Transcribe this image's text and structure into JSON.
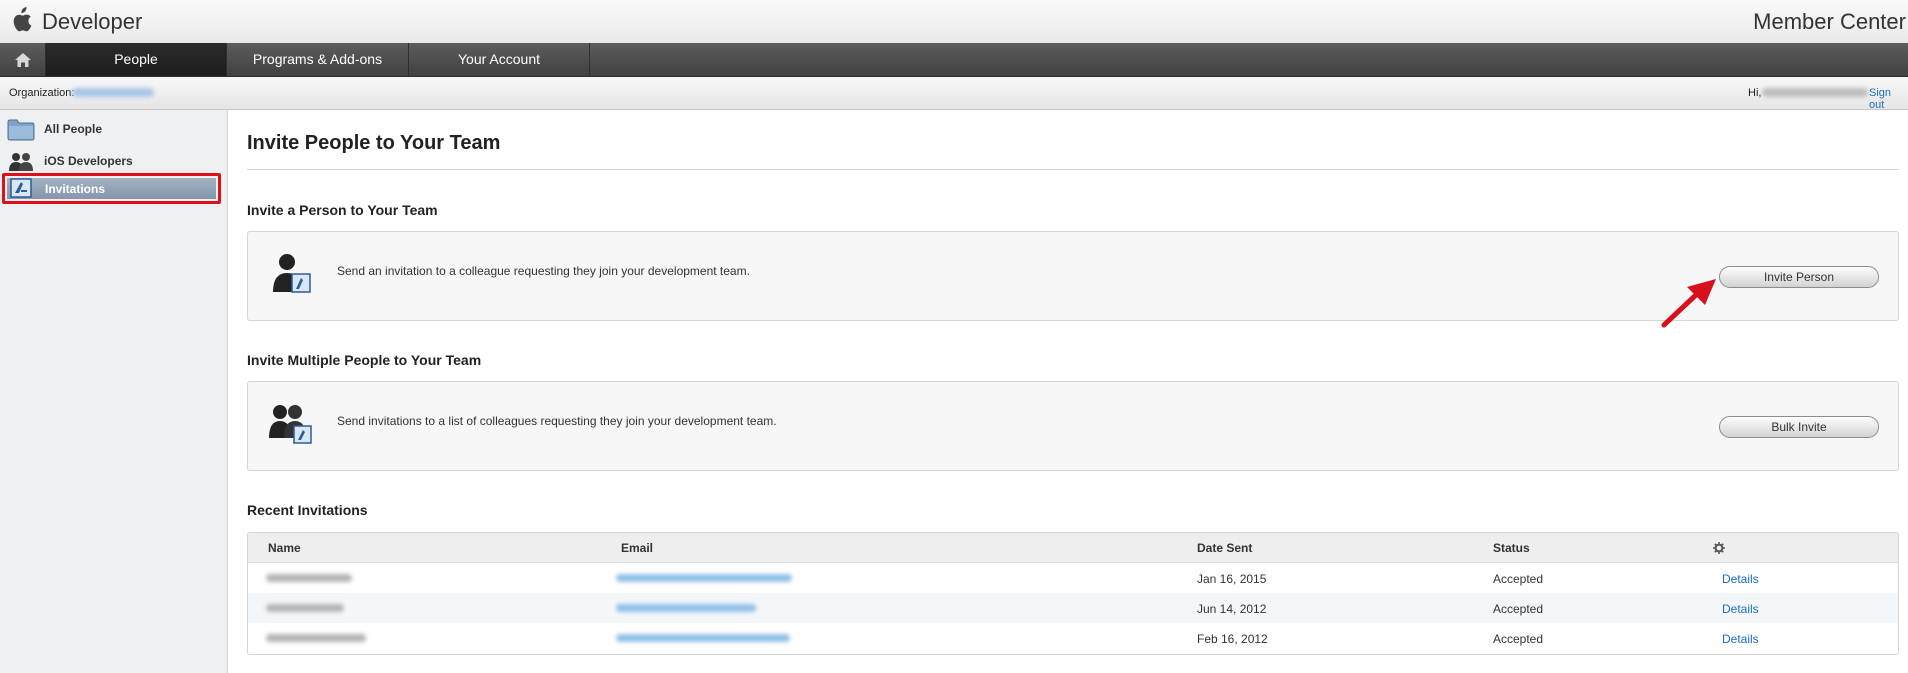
{
  "header": {
    "brand": "Developer",
    "member_center": "Member Center"
  },
  "nav": {
    "tabs": [
      {
        "label": "People",
        "active": true
      },
      {
        "label": "Programs & Add-ons",
        "active": false
      },
      {
        "label": "Your Account",
        "active": false
      }
    ]
  },
  "subbar": {
    "organization_label": "Organization:",
    "greeting": "Hi,",
    "sign_out": "Sign out"
  },
  "sidebar": {
    "items": [
      {
        "label": "All People",
        "icon": "folder-icon"
      },
      {
        "label": "iOS Developers",
        "icon": "people-icon"
      },
      {
        "label": "Invitations",
        "icon": "invitation-icon",
        "active": true
      }
    ]
  },
  "main": {
    "title": "Invite People to Your Team",
    "invite_person": {
      "heading": "Invite a Person to Your Team",
      "description": "Send an invitation to a colleague requesting they join your development team.",
      "button": "Invite Person"
    },
    "invite_multiple": {
      "heading": "Invite Multiple People to Your Team",
      "description": "Send invitations to a list of colleagues requesting they join your development team.",
      "button": "Bulk Invite"
    },
    "recent": {
      "heading": "Recent Invitations",
      "columns": [
        "Name",
        "Email",
        "Date Sent",
        "Status"
      ],
      "rows": [
        {
          "date": "Jan 16, 2015",
          "status": "Accepted",
          "action": "Details"
        },
        {
          "date": "Jun 14, 2012",
          "status": "Accepted",
          "action": "Details"
        },
        {
          "date": "Feb 16, 2012",
          "status": "Accepted",
          "action": "Details"
        }
      ]
    }
  },
  "colors": {
    "link": "#1a6fc0",
    "highlight": "#e0101b",
    "nav_bg": "#4a4a4a"
  }
}
